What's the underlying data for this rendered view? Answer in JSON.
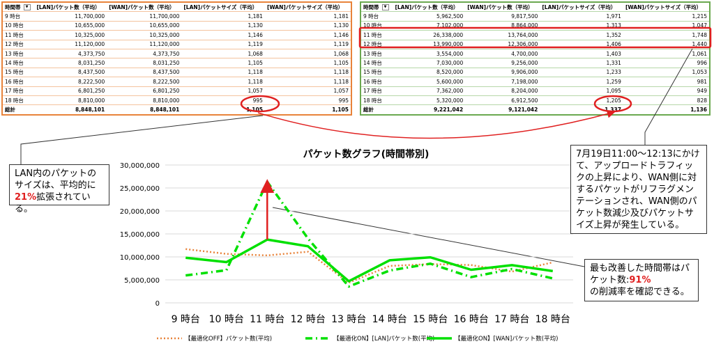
{
  "left_table": {
    "headers": [
      "時間帯",
      "[LAN]パケット数（平均）",
      "[WAN]パケット数（平均）",
      "[LAN]パケットサイズ（平均）",
      "[WAN]パケットサイズ（平均）"
    ],
    "rows": [
      [
        "9 時台",
        "11,700,000",
        "11,700,000",
        "1,181",
        "1,181"
      ],
      [
        "10 時台",
        "10,655,000",
        "10,655,000",
        "1,130",
        "1,130"
      ],
      [
        "11 時台",
        "10,325,000",
        "10,325,000",
        "1,146",
        "1,146"
      ],
      [
        "12 時台",
        "11,120,000",
        "11,120,000",
        "1,119",
        "1,119"
      ],
      [
        "13 時台",
        "4,373,750",
        "4,373,750",
        "1,068",
        "1,068"
      ],
      [
        "14 時台",
        "8,031,250",
        "8,031,250",
        "1,105",
        "1,105"
      ],
      [
        "15 時台",
        "8,437,500",
        "8,437,500",
        "1,118",
        "1,118"
      ],
      [
        "16 時台",
        "8,222,500",
        "8,222,500",
        "1,118",
        "1,118"
      ],
      [
        "17 時台",
        "6,801,250",
        "6,801,250",
        "1,057",
        "1,057"
      ],
      [
        "18 時台",
        "8,810,000",
        "8,810,000",
        "995",
        "995"
      ]
    ],
    "total": [
      "総計",
      "8,848,101",
      "8,848,101",
      "1,105",
      "1,105"
    ]
  },
  "right_table": {
    "headers": [
      "時間帯",
      "[LAN]パケット数（平均）",
      "[WAN]パケット数（平均）",
      "[LAN]パケットサイズ（平均）",
      "[WAN]パケットサイズ（平均）"
    ],
    "rows": [
      [
        "9 時台",
        "5,962,500",
        "9,817,500",
        "1,971",
        "1,215"
      ],
      [
        "10 時台",
        "7,102,000",
        "8,864,000",
        "1,313",
        "1,047"
      ],
      [
        "11 時台",
        "26,338,000",
        "13,764,000",
        "1,352",
        "1,748"
      ],
      [
        "12 時台",
        "13,990,000",
        "12,306,000",
        "1,406",
        "1,440"
      ],
      [
        "13 時台",
        "3,554,000",
        "4,700,000",
        "1,403",
        "1,061"
      ],
      [
        "14 時台",
        "7,030,000",
        "9,256,000",
        "1,331",
        "996"
      ],
      [
        "15 時台",
        "8,520,000",
        "9,906,000",
        "1,233",
        "1,053"
      ],
      [
        "16 時台",
        "5,600,000",
        "7,198,000",
        "1,259",
        "981"
      ],
      [
        "17 時台",
        "7,362,000",
        "8,204,000",
        "1,095",
        "949"
      ],
      [
        "18 時台",
        "5,320,000",
        "6,912,500",
        "1,205",
        "828"
      ]
    ],
    "total": [
      "総計",
      "9,221,042",
      "9,121,042",
      "1,337",
      "1,136"
    ]
  },
  "callouts": {
    "left_prefix": "LAN内のパケットのサイズは、平均的に",
    "left_highlight": "21%",
    "left_suffix": "拡張されている。",
    "right_top": "7月19日11:00～12:13にかけて、アップロードトラフィックの上昇により、WAN側に対するパケットがリフラグメンテーションされ、WAN側のパケット数減少及びパケットサイズ上昇が発生している。",
    "right_bottom_prefix": "最も改善した時間帯はパケット数:",
    "right_bottom_highlight": "91%",
    "right_bottom_suffix": "の削減率を確認できる。"
  },
  "colors": {
    "orange": "#e8833a",
    "green": "#00e000",
    "red": "#e02020",
    "table_left_border": "#e8833a",
    "table_right_border": "#6aa84f"
  },
  "chart_data": {
    "type": "line",
    "title": "パケット数グラフ(時間帯別)",
    "categories": [
      "9 時台",
      "10 時台",
      "11 時台",
      "12 時台",
      "13 時台",
      "14 時台",
      "15 時台",
      "16 時台",
      "17 時台",
      "18 時台"
    ],
    "y_ticks": [
      "30,000,000",
      "25,000,000",
      "20,000,000",
      "15,000,000",
      "10,000,000",
      "5,000,000",
      "0"
    ],
    "ylim": [
      0,
      30000000
    ],
    "grid": true,
    "legend_position": "bottom",
    "series": [
      {
        "name": "【最適化OFF】パケット数(平均)",
        "color": "#e8833a",
        "style": "dotted",
        "values": [
          11700000,
          10655000,
          10325000,
          11120000,
          4373750,
          8031250,
          8437500,
          8222500,
          6801250,
          8810000
        ]
      },
      {
        "name": "【最適化ON】[LAN]パケット数(平均)",
        "color": "#00e000",
        "style": "dashdot",
        "values": [
          5962500,
          7102000,
          26338000,
          13990000,
          3554000,
          7030000,
          8520000,
          5600000,
          7362000,
          5320000
        ]
      },
      {
        "name": "【最適化ON】[WAN]パケット数(平均)",
        "color": "#00e000",
        "style": "solid",
        "values": [
          9817500,
          8864000,
          13764000,
          12306000,
          4700000,
          9256000,
          9906000,
          7198000,
          8204000,
          6912500
        ]
      }
    ]
  }
}
